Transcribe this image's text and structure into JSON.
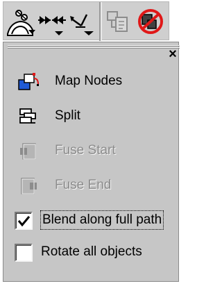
{
  "toolbar": {
    "buttons": [
      {
        "name": "blend-preset-icon",
        "enabled": true
      },
      {
        "name": "blend-steps-icon",
        "enabled": true
      },
      {
        "name": "blend-direction-icon",
        "enabled": true
      },
      {
        "name": "copy-blend-icon",
        "enabled": false
      },
      {
        "name": "clear-blend-icon",
        "enabled": true
      }
    ]
  },
  "panel": {
    "close_glyph": "×",
    "commands": [
      {
        "label": "Map Nodes",
        "icon": "map-nodes-icon",
        "enabled": true
      },
      {
        "label": "Split",
        "icon": "split-icon",
        "enabled": true
      },
      {
        "label": "Fuse Start",
        "icon": "fuse-start-icon",
        "enabled": false
      },
      {
        "label": "Fuse End",
        "icon": "fuse-end-icon",
        "enabled": false
      }
    ],
    "options": [
      {
        "label": "Blend along full path",
        "checked": true,
        "focused": true
      },
      {
        "label": "Rotate all objects",
        "checked": false,
        "focused": false
      }
    ]
  },
  "colors": {
    "panel_bg": "#c6c6c6",
    "toolbar_bg": "#cfcfcf",
    "disabled_text": "#8c8c8c",
    "clear_icon_red": "#e01818",
    "map_nodes_blue": "#1f5ad6"
  }
}
